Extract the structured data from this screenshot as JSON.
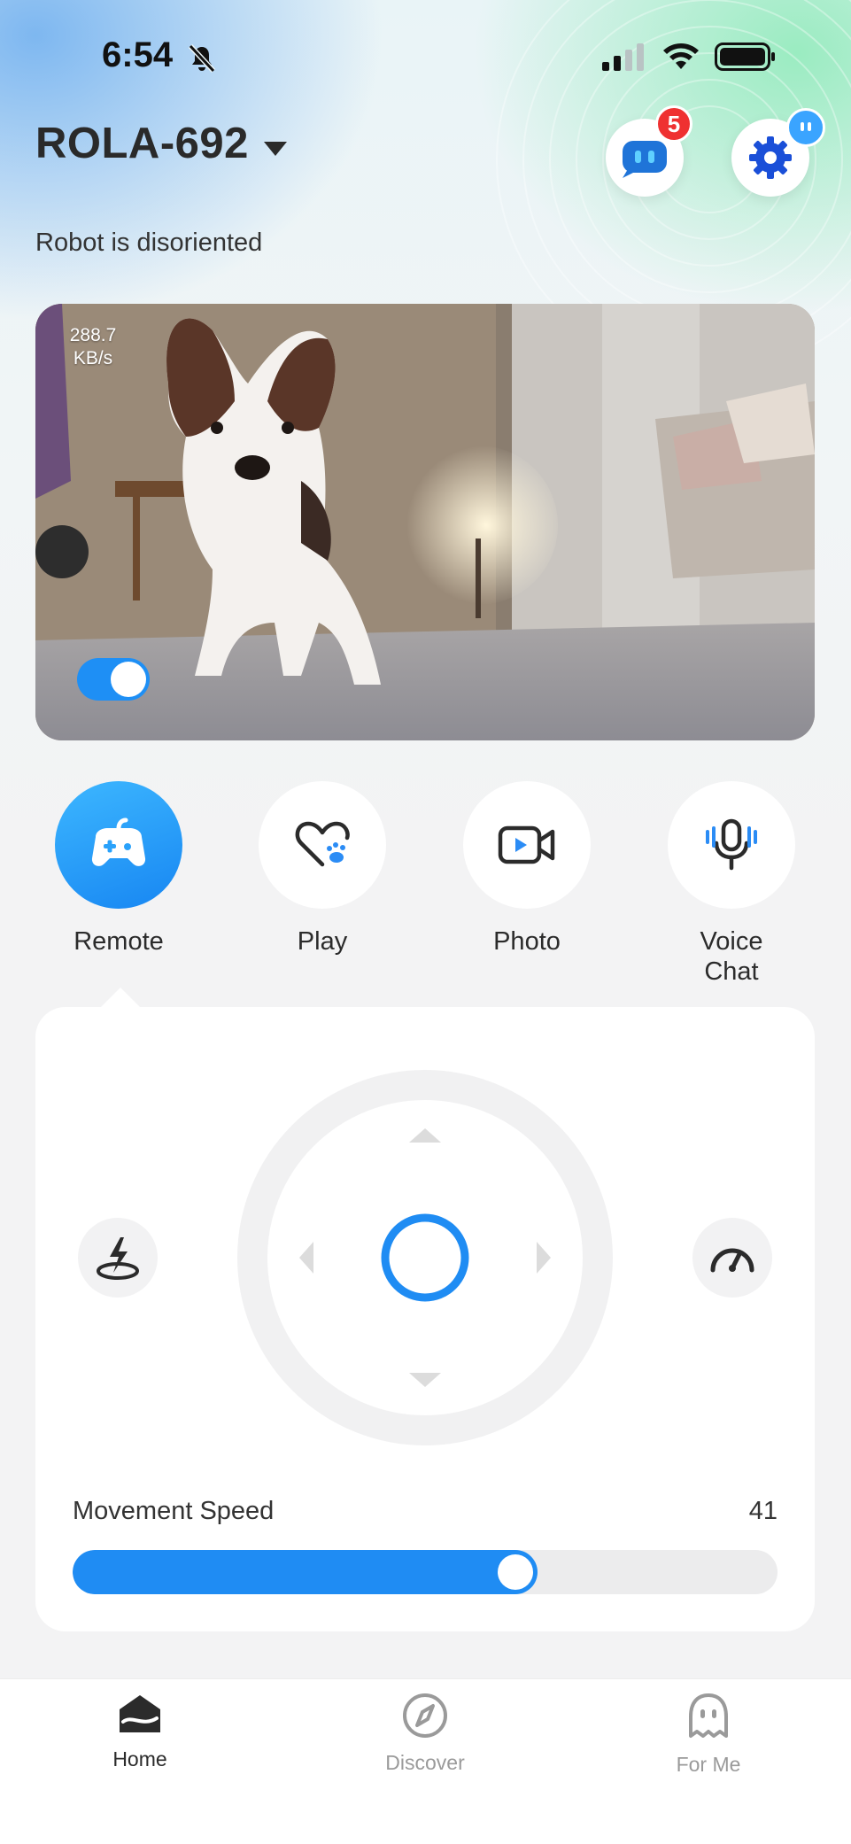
{
  "status_bar": {
    "time": "6:54"
  },
  "header": {
    "device_name": "ROLA-692",
    "messages_badge": "5",
    "robot_status": "Robot is disoriented"
  },
  "camera": {
    "bitrate_value": "288.7",
    "bitrate_unit": "KB/s",
    "toggle_on": true
  },
  "actions": [
    {
      "label": "Remote",
      "icon": "gamepad-icon",
      "active": true
    },
    {
      "label": "Play",
      "icon": "heart-paw-icon",
      "active": false
    },
    {
      "label": "Photo",
      "icon": "video-camera-icon",
      "active": false
    },
    {
      "label": "Voice Chat",
      "icon": "microphone-icon",
      "active": false
    }
  ],
  "control": {
    "speed_label": "Movement Speed",
    "speed_value": "41",
    "speed_fraction": 0.66,
    "left_icon": "recharge-dock-icon",
    "right_icon": "speedometer-icon"
  },
  "tabs": [
    {
      "label": "Home",
      "icon": "home-icon",
      "active": true
    },
    {
      "label": "Discover",
      "icon": "compass-icon",
      "active": false
    },
    {
      "label": "For Me",
      "icon": "robot-face-icon",
      "active": false
    }
  ],
  "colors": {
    "accent": "#1f8cf3",
    "badge": "#ef3131",
    "tab_active": "#2b2b2b",
    "tab_inactive": "#9a9a9a"
  }
}
